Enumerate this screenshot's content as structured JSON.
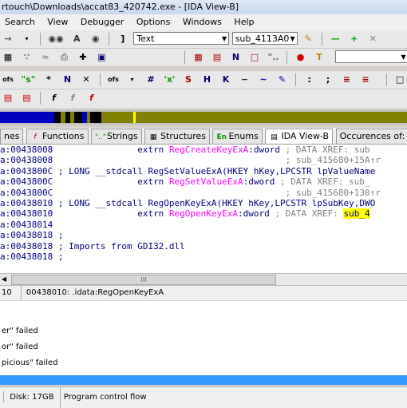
{
  "window": {
    "title": "rtouch\\Downloads\\accat83_420742.exe - [IDA View-B]"
  },
  "menu": [
    "Search",
    "View",
    "Debugger",
    "Options",
    "Windows",
    "Help"
  ],
  "toolbar": {
    "mode_combo_value": "Text",
    "function_combo_value": "sub_4113A0"
  },
  "nav_colors": {
    "blue": "#0000c0",
    "olive": "#808000",
    "black": "#000000",
    "yellow": "#ffff00",
    "gray": "#c0c0c0"
  },
  "tabs": [
    {
      "label": "nes",
      "icon": ""
    },
    {
      "label": "Functions",
      "icon": "function-icon"
    },
    {
      "label": "Strings",
      "icon": "strings-icon",
      "prefix": "\"..\""
    },
    {
      "label": "Structures",
      "icon": "structures-icon"
    },
    {
      "label": "Enums",
      "icon": "enums-icon",
      "prefix": "En"
    },
    {
      "label": "IDA View-B",
      "icon": "view-icon",
      "active": true
    },
    {
      "label": "Occurences of: RegOpenKey",
      "icon": ""
    }
  ],
  "code_lines": [
    {
      "addr": "a:00438008",
      "body": "                extrn RegCreateKeyExA:dword ; DATA XREF: sub",
      "type": "extrn"
    },
    {
      "addr": "a:00438008",
      "body": "                                            ; sub_415680+15A↑r",
      "type": "cmt"
    },
    {
      "addr": "a:0043800C",
      "body": " ; LONG __stdcall RegSetValueExA(HKEY hKey,LPCSTR lpValueName",
      "type": "proto"
    },
    {
      "addr": "a:0043800C",
      "body": "                extrn RegSetValueExA:dword ; DATA XREF: sub_",
      "type": "extrn"
    },
    {
      "addr": "a:0043800C",
      "body": "                                            ; sub_415680+130↑r",
      "type": "cmt"
    },
    {
      "addr": "a:00438010",
      "body": " ; LONG __stdcall RegOpenKeyExA(HKEY hKey,LPCSTR lpSubKey,DWO",
      "type": "proto"
    },
    {
      "addr": "a:00438010",
      "body": "                extrn RegOpenKeyExA:dword ; DATA XREF: ",
      "type": "extrn_hl",
      "hl": "sub_4"
    },
    {
      "addr": "a:00438014",
      "body": "",
      "type": "blank"
    },
    {
      "addr": "a:00438018",
      "body": " ;",
      "type": "proto"
    },
    {
      "addr": "a:00438018",
      "body": " ; Imports from GDI32.dll",
      "type": "proto"
    },
    {
      "addr": "a:00438018",
      "body": " ;",
      "type": "proto"
    }
  ],
  "hscroll": {
    "thumb_text": "III"
  },
  "status": {
    "left": "10",
    "location": "00438010: .idata:RegOpenKeyExA"
  },
  "output": [
    "er\" failed",
    "or\" failed",
    "picious\" failed"
  ],
  "bottom": {
    "disk": "Disk: 17GB",
    "state": "Program control flow"
  }
}
